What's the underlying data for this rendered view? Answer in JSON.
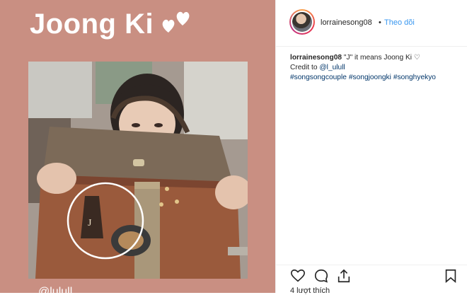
{
  "media": {
    "title": "Joong Ki",
    "photo_caption": "@lulull"
  },
  "post": {
    "username": "lorrainesong08",
    "separator": "•",
    "follow_label": "Theo dõi",
    "caption": {
      "username": "lorrainesong08",
      "text": "\"J\" it means Joong Ki ♡",
      "credit_prefix": "Credit to ",
      "credit_mention": "@l_ulull",
      "hashtags": [
        "#songsongcouple",
        "#songjoongki",
        "#songhyekyo"
      ]
    },
    "likes_label": "4 lượt thích"
  },
  "icons": {
    "hearts": "hearts-icon",
    "like": "heart-outline-icon",
    "comment": "comment-icon",
    "share": "share-icon",
    "save": "bookmark-icon"
  },
  "colors": {
    "panel_bg": "#c98f82",
    "link": "#3897f0",
    "hashtag": "#003569",
    "text": "#262626"
  }
}
